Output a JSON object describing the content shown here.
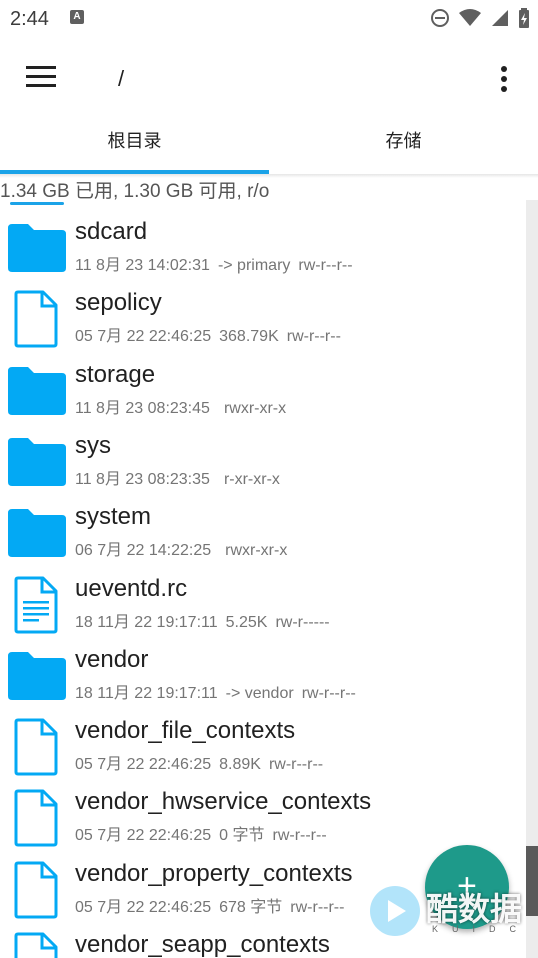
{
  "status_bar": {
    "time": "2:44",
    "badge": "A"
  },
  "app_bar": {
    "path": "/"
  },
  "tabs": [
    {
      "label": "根目录"
    },
    {
      "label": "存储"
    }
  ],
  "storage_info": "1.34 GB 已用, 1.30 GB 可用, r/o",
  "files": [
    {
      "name": "sdcard",
      "type": "folder",
      "date": "11 8月 23 14:02:31",
      "info": "-> primary",
      "perms": "rw-r--r--"
    },
    {
      "name": "sepolicy",
      "type": "file",
      "date": "05 7月 22 22:46:25",
      "info": "368.79K",
      "perms": "rw-r--r--"
    },
    {
      "name": "storage",
      "type": "folder",
      "date": "11 8月 23 08:23:45",
      "info": "",
      "perms": "rwxr-xr-x"
    },
    {
      "name": "sys",
      "type": "folder",
      "date": "11 8月 23 08:23:35",
      "info": "",
      "perms": "r-xr-xr-x"
    },
    {
      "name": "system",
      "type": "folder",
      "date": "06 7月 22 14:22:25",
      "info": "",
      "perms": "rwxr-xr-x"
    },
    {
      "name": "ueventd.rc",
      "type": "text",
      "date": "18 11月 22 19:17:11",
      "info": "5.25K",
      "perms": "rw-r-----"
    },
    {
      "name": "vendor",
      "type": "folder",
      "date": "18 11月 22 19:17:11",
      "info": "-> vendor",
      "perms": "rw-r--r--"
    },
    {
      "name": "vendor_file_contexts",
      "type": "file",
      "date": "05 7月 22 22:46:25",
      "info": "8.89K",
      "perms": "rw-r--r--"
    },
    {
      "name": "vendor_hwservice_contexts",
      "type": "file",
      "date": "05 7月 22 22:46:25",
      "info": "0 字节",
      "perms": "rw-r--r--"
    },
    {
      "name": "vendor_property_contexts",
      "type": "file",
      "date": "05 7月 22 22:46:25",
      "info": "678 字节",
      "perms": "rw-r--r--"
    },
    {
      "name": "vendor_seapp_contexts",
      "type": "file",
      "date": "",
      "info": "",
      "perms": ""
    }
  ],
  "fab": {
    "icon": "plus-icon"
  },
  "watermark": {
    "text": "酷数据",
    "sub": "KUIDC"
  },
  "colors": {
    "accent": "#1ba3e8",
    "folder": "#03a9f4",
    "fab": "#1e9a8a"
  }
}
